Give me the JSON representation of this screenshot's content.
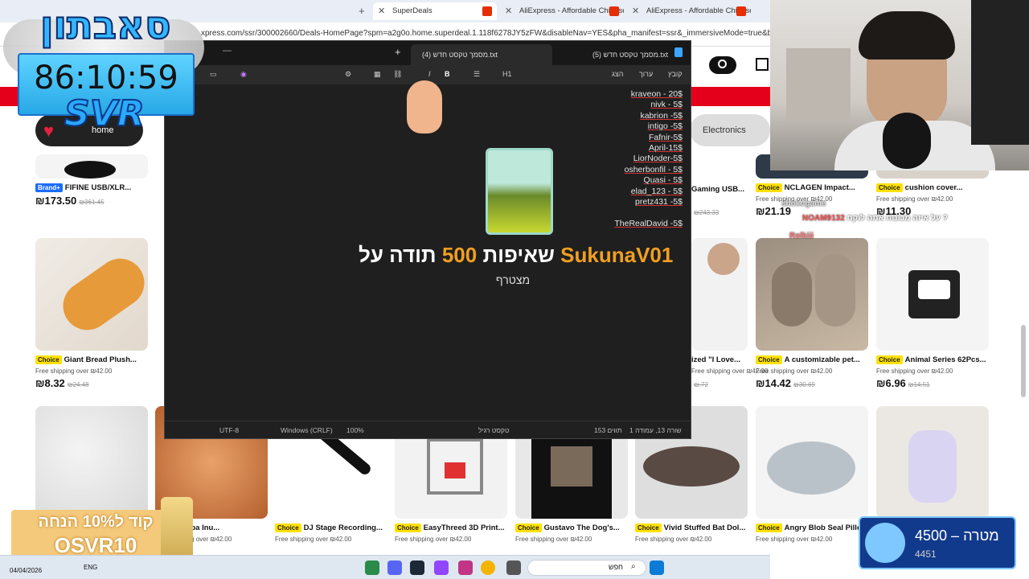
{
  "browser": {
    "tabs": [
      {
        "label": "SuperDeals",
        "active": true
      },
      {
        "label": "AliExpress - Affordable Chinese",
        "active": false
      },
      {
        "label": "AliExpress - Affordable Chinese",
        "active": false
      }
    ],
    "url": "xpress.com/ssr/300002660/Deals-HomePage?spm=a2g0o.home.superdeal.1.118f6278JY5zFW&disableNav=YES&pha_manifest=ssr&_immersiveMode=true&businessCode",
    "new_tab_glyph": "+"
  },
  "store": {
    "category_pills": [
      "home decor",
      "Electronics"
    ],
    "products_row1": [
      {
        "brand_badge": "Brand+",
        "title": "FIFINE USB/XLR...",
        "price": "₪173.50",
        "old": "₪361.45"
      },
      {
        "title": "Gaming USB...",
        "old": "₪243.33"
      },
      {
        "badge": "Choice",
        "title": "NCLAGEN Impact...",
        "ship": "Free shipping over ₪42.00",
        "price": "₪21.19"
      },
      {
        "badge": "Choice",
        "title": "cushion cover...",
        "ship": "Free shipping over ₪42.00",
        "price": "₪11.30"
      }
    ],
    "products_row2": [
      {
        "badge": "Choice",
        "title": "Giant Bread Plush...",
        "ship": "Free shipping over ₪42.00",
        "price": "₪8.32",
        "old": "₪24.48"
      },
      {
        "title": "ized \"I Love...",
        "ship": "Free shipping over ₪42.00",
        "old": "₪.72"
      },
      {
        "badge": "Choice",
        "title": "A customizable pet...",
        "ship": "Free shipping over ₪42.00",
        "price": "₪14.42",
        "old": "₪30.69"
      },
      {
        "badge": "Choice",
        "title": "Animal Series 62Pcs...",
        "ship": "Free shipping over ₪42.00",
        "price": "₪6.96",
        "old": "₪14.51"
      }
    ],
    "products_row3": [
      {
        "title": "eative Shiba Inu...",
        "ship": "Free shipping over ₪42.00"
      },
      {
        "badge": "Choice",
        "title": "DJ Stage Recording...",
        "ship": "Free shipping over ₪42.00"
      },
      {
        "badge": "Choice",
        "title": "EasyThreed 3D Print...",
        "ship": "Free shipping over ₪42.00"
      },
      {
        "badge": "Choice",
        "title": "Gustavo The Dog's...",
        "ship": "Free shipping over ₪42.00"
      },
      {
        "badge": "Choice",
        "title": "Vivid Stuffed Bat Dol...",
        "ship": "Free shipping over ₪42.00"
      },
      {
        "badge": "Choice",
        "title": "Angry Blob Seal Pillo...",
        "ship": "Free shipping over ₪42.00"
      }
    ]
  },
  "notepad": {
    "tabs": [
      {
        "label": "מסמך טקסט חדש (4).txt",
        "active": true
      },
      {
        "label": "מסמך טקסט חדש (5).txt",
        "active": false
      }
    ],
    "menu": [
      "קובץ",
      "ערוך",
      "הצג"
    ],
    "heading_label": "H1",
    "lines": [
      "kraveon - 20$",
      "nivk - 5$",
      "kabrion -5$",
      "intigo -5$",
      "Fafnir-5$",
      "April-15$",
      "LiorNoder-5$",
      "osherbonfil - 5$",
      "Quasi - 5$",
      "elad_123 - 5$",
      "pretz431 -5$",
      "",
      "TheRealDavid -5$"
    ],
    "status": {
      "position": "שורה 13, עמודה 1",
      "chars": "153 תווים",
      "format": "טקסט רגיל",
      "zoom": "100%",
      "eol": "Windows (CRLF)",
      "encoding": "UTF-8"
    }
  },
  "alert": {
    "username": "SukunaV01",
    "text_pre": "תודה על",
    "amount": "500",
    "text_post": "שאיפות",
    "subtitle": "מצטרף"
  },
  "overlay": {
    "logo_text": "סאבתון",
    "timer": "86:10:59",
    "svr": "SVR",
    "promo_line1": "קוד ל10% הנחה",
    "promo_line2": "OSVR10",
    "goal_label": "מטרה",
    "goal_target": "4500",
    "goal_current": "4451"
  },
  "chat": [
    {
      "user": "shokogame",
      "text": ""
    },
    {
      "user": "NOAM9132",
      "text": "על איזה מכונות אתה לוקח ?"
    },
    {
      "user": "Rolkiii",
      "text": ""
    }
  ],
  "taskbar": {
    "date": "04/04/2026",
    "lang": "ENG",
    "search_placeholder": "חפש"
  },
  "colors": {
    "accent_red": "#e4001a",
    "alert_gold": "#f0a020",
    "timer_blue": "#27a8e6"
  }
}
